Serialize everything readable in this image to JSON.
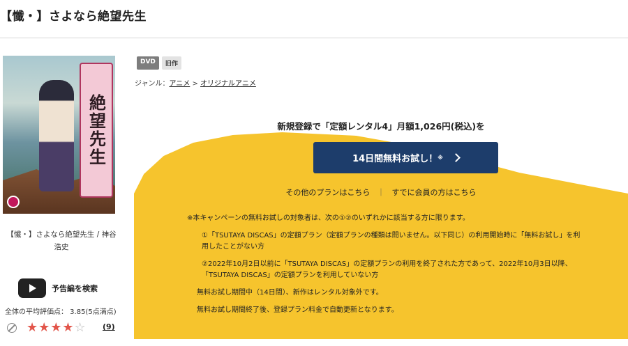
{
  "page": {
    "title": "【懺・】さよなら絶望先生"
  },
  "cover": {
    "title_art": "絶望先生"
  },
  "sidebar": {
    "title_line1": "【懺・】さよなら絶望先生 / 神谷",
    "title_line2": "浩史",
    "trailer_label": "予告編を検索",
    "rating_text": "全体の平均評価点： 3.85(5点満点)",
    "rating_value": 3.85,
    "rating_max": 5,
    "stars_full": "★★★★",
    "stars_empty": "☆",
    "review_count": "(9)"
  },
  "badges": {
    "dvd": "DVD",
    "old": "旧作"
  },
  "genre": {
    "label": "ジャンル：",
    "link1": "アニメ",
    "sep": " > ",
    "link2": "オリジナルアニメ"
  },
  "promo": {
    "heading": "新規登録で「定額レンタル4」月額1,026円(税込)を",
    "cta_label": "14日間無料お試し！",
    "cta_note": "※",
    "other_plans": "その他のプランはこちら",
    "separator": "｜",
    "member_link": "すでに会員の方はこちら"
  },
  "terms": {
    "intro": "※本キャンペーンの無料お試しの対象者は、次の①②のいずれかに該当する方に限ります。",
    "item1_line1": "①「TSUTAYA DISCAS」の定額プラン（定額プランの種類は問いません。以下同じ）の利用開始時に「無料お試し」を利",
    "item1_line2": "用したことがない方",
    "item2_line1": "②2022年10月2日以前に「TSUTAYA DISCAS」の定額プランの利用を終了された方であって、2022年10月3日以降、",
    "item2_line2": "「TSUTAYA DISCAS」の定額プランを利用していない方",
    "note1": "無料お試し期間中（14日間）、新作はレンタル対象外です。",
    "note2": "無料お試し期間終了後、登録プラン料金で自動更新となります。"
  },
  "colors": {
    "accent_yellow": "#f6c42d",
    "cta_navy": "#1d3d6b",
    "star_red": "#e2554a"
  }
}
